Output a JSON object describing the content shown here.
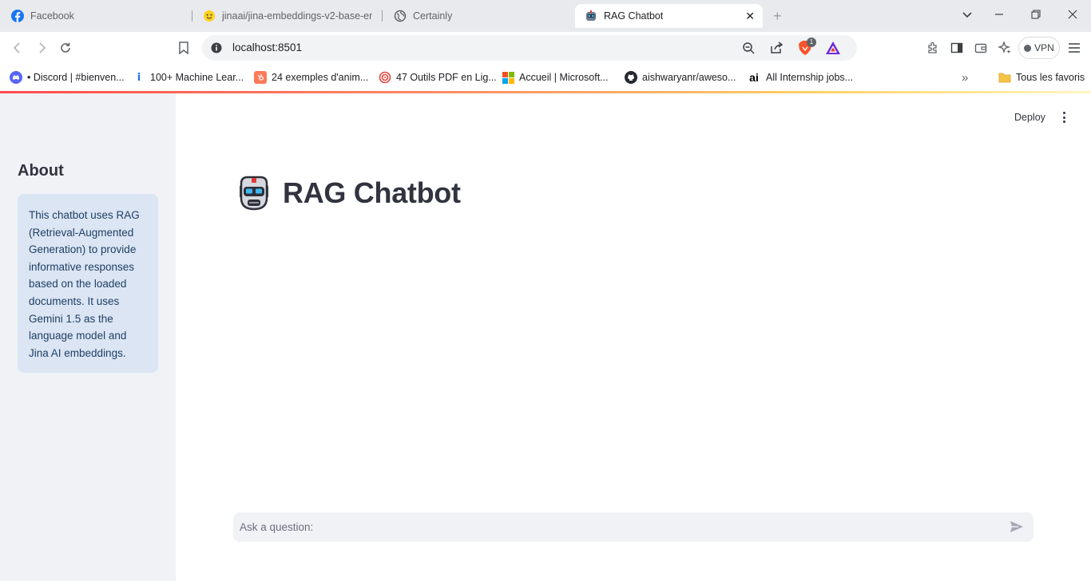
{
  "tabs": [
    {
      "title": "Facebook",
      "icon": "facebook-icon"
    },
    {
      "title": "jinaai/jina-embeddings-v2-base-en",
      "icon": "huggingface-icon"
    },
    {
      "title": "Certainly",
      "icon": "globe-icon"
    },
    {
      "title": "RAG Chatbot",
      "icon": "robot-icon",
      "active": true,
      "close": "✕"
    }
  ],
  "address": {
    "url": "localhost:8501",
    "shield_badge": "1"
  },
  "vpn_label": "VPN",
  "bookmarks": [
    {
      "label": "• Discord | #bienven...",
      "icon": "discord-icon",
      "color": "#5865f2"
    },
    {
      "label": "100+ Machine Lear...",
      "icon": "info-icon",
      "color": "#1a73e8"
    },
    {
      "label": "24 exemples d'anim...",
      "icon": "hubspot-icon",
      "color": "#ff7a59"
    },
    {
      "label": "47 Outils PDF en Lig...",
      "icon": "target-icon",
      "color": "#e8453c"
    },
    {
      "label": "Accueil | Microsoft...",
      "icon": "microsoft-icon",
      "color": "#f25022"
    },
    {
      "label": "aishwaryanr/aweso...",
      "icon": "github-icon",
      "color": "#24292f"
    },
    {
      "label": "All Internship jobs...",
      "icon": "ai-icon",
      "color": "#000000"
    }
  ],
  "bookmarks_overflow": "»",
  "favorites_label": "Tous les favoris",
  "sidebar": {
    "heading": "About",
    "info": "This chatbot uses RAG (Retrieval-Augmented Generation) to provide informative responses based on the loaded documents. It uses Gemini 1.5 as the language model and Jina AI embeddings."
  },
  "header": {
    "deploy_label": "Deploy"
  },
  "main": {
    "title": "RAG Chatbot"
  },
  "chat": {
    "placeholder": "Ask a question:"
  },
  "colors": {
    "accent": "#ff4b4b",
    "sidebar_bg": "#f0f2f6",
    "info_bg": "#dbe5f3",
    "info_text": "#1f3f66"
  }
}
